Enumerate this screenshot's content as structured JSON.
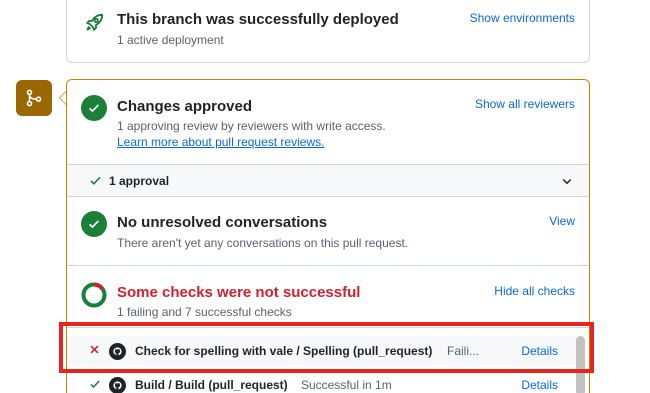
{
  "deployment": {
    "title": "This branch was successfully deployed",
    "subtitle": "1 active deployment",
    "link": "Show environments"
  },
  "approval": {
    "title": "Changes approved",
    "desc": "1 approving review by reviewers with write access.",
    "learn_more": "Learn more about pull request reviews.",
    "link": "Show all reviewers",
    "count_label": "1 approval"
  },
  "conversations": {
    "title": "No unresolved conversations",
    "desc": "There aren't yet any conversations on this pull request.",
    "link": "View"
  },
  "checks": {
    "title": "Some checks were not successful",
    "summary": "1 failing and 7 successful checks",
    "link": "Hide all checks",
    "items": [
      {
        "name": "Check for spelling with vale / Spelling (pull_request)",
        "state": "Faili...",
        "details": "Details",
        "status": "failed"
      },
      {
        "name": "Build / Build (pull_request)",
        "state": "Successful in 1m",
        "details": "Details",
        "status": "success"
      }
    ]
  },
  "colors": {
    "success": "#1a7f37",
    "danger": "#cf222e",
    "link": "#0969da",
    "attention": "#bf8700",
    "highlight": "#e6251e"
  }
}
